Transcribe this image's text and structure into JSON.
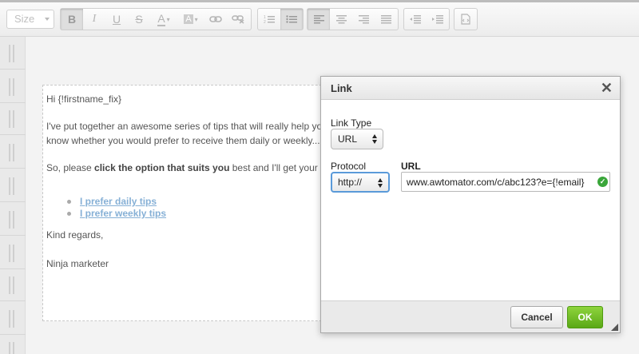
{
  "toolbar": {
    "size_label": "Size",
    "buttons": [
      "B",
      "I",
      "U",
      "S",
      "A",
      "A"
    ]
  },
  "email": {
    "greeting": "Hi {!firstname_fix}",
    "line1": "I've put together an awesome series of tips that will really help yo",
    "line2": "know whether you would prefer to receive them daily or weekly...",
    "line3_pre": "So, please ",
    "line3_bold": "click the option that suits you",
    "line3_post": " best and I'll get your",
    "links": [
      "I prefer daily tips",
      "I prefer weekly tips"
    ],
    "closing": "Kind regards,",
    "signature": "Ninja marketer"
  },
  "dialog": {
    "title": "Link",
    "link_type_label": "Link Type",
    "link_type_value": "URL",
    "protocol_label": "Protocol",
    "protocol_value": "http://",
    "url_label": "URL",
    "url_value": "www.awtomator.com/c/abc123?e={!email}",
    "cancel_label": "Cancel",
    "ok_label": "OK"
  },
  "colors": {
    "accent_green": "#6bbf22",
    "link_blue": "#86b0d6",
    "focus_blue": "#5a9ad9"
  }
}
